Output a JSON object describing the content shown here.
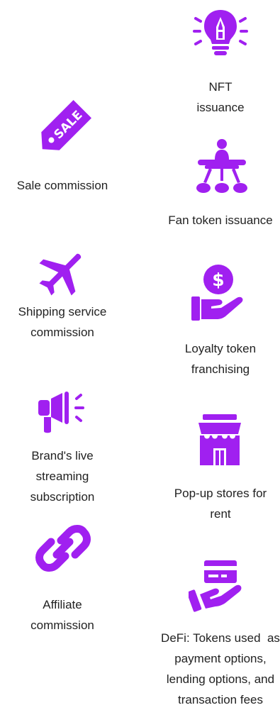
{
  "accent_color": "#a020f0",
  "text_color": "#222222",
  "left_column": [
    {
      "icon": "sale-tag-icon",
      "label": [
        "Sale commission"
      ]
    },
    {
      "icon": "airplane-icon",
      "label": [
        "Shipping service",
        "commission"
      ]
    },
    {
      "icon": "megaphone-icon",
      "label": [
        "Brand's live",
        "streaming",
        "subscription"
      ]
    },
    {
      "icon": "chain-link-icon",
      "label": [
        "Affiliate",
        "commission"
      ]
    }
  ],
  "right_column": [
    {
      "icon": "lightbulb-pen-icon",
      "label": [
        "NFT",
        "issuance"
      ]
    },
    {
      "icon": "hub-network-icon",
      "label": [
        "Fan token issuance"
      ]
    },
    {
      "icon": "coin-hand-icon",
      "label": [
        "Loyalty token",
        "franchising"
      ]
    },
    {
      "icon": "storefront-icon",
      "label": [
        "Pop-up stores for",
        "rent"
      ]
    },
    {
      "icon": "card-hand-icon",
      "label": [
        "DeFi: Tokens used  as",
        "payment options,",
        "lending options, and",
        "transaction fees"
      ]
    }
  ]
}
